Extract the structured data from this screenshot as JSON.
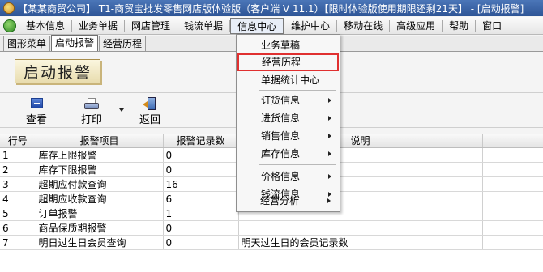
{
  "window": {
    "title": "【某某商贸公司】 T1-商贸宝批发零售网店版体验版（客户端 V 11.1）【限时体验版使用期限还剩21天】 - [启动报警]"
  },
  "menubar": {
    "items": [
      {
        "label": "基本信息"
      },
      {
        "label": "业务单据"
      },
      {
        "label": "网店管理"
      },
      {
        "label": "钱流单据"
      },
      {
        "label": "信息中心"
      },
      {
        "label": "维护中心"
      },
      {
        "label": "移动在线"
      },
      {
        "label": "高级应用"
      },
      {
        "label": "帮助"
      },
      {
        "label": "窗口"
      }
    ],
    "active_index": 4
  },
  "tabs": [
    {
      "label": "图形菜单"
    },
    {
      "label": "启动报警"
    },
    {
      "label": "经营历程"
    }
  ],
  "caption": "启动报警",
  "toolbar": {
    "view_label": "查看",
    "print_label": "打印",
    "back_label": "返回"
  },
  "table": {
    "columns": [
      "行号",
      "报警项目",
      "报警记录数",
      "说明"
    ],
    "rows": [
      {
        "no": "1",
        "item": "库存上限报警",
        "count": "0",
        "note": ""
      },
      {
        "no": "2",
        "item": "库存下限报警",
        "count": "0",
        "note": ""
      },
      {
        "no": "3",
        "item": "超期应付款查询",
        "count": "16",
        "note": ""
      },
      {
        "no": "4",
        "item": "超期应收款查询",
        "count": "6",
        "note": ""
      },
      {
        "no": "5",
        "item": "订单报警",
        "count": "1",
        "note": ""
      },
      {
        "no": "6",
        "item": "商品保质期报警",
        "count": "0",
        "note": ""
      },
      {
        "no": "7",
        "item": "明日过生日会员查询",
        "count": "0",
        "note": "明天过生日的会员记录数"
      }
    ]
  },
  "dropdown": {
    "items": [
      {
        "label": "业务草稿",
        "submenu": false
      },
      {
        "label": "经营历程",
        "submenu": false,
        "highlighted": true
      },
      {
        "label": "单据统计中心",
        "submenu": false
      },
      {
        "label": "订货信息",
        "submenu": true
      },
      {
        "label": "进货信息",
        "submenu": true
      },
      {
        "label": "销售信息",
        "submenu": true
      },
      {
        "label": "库存信息",
        "submenu": true
      },
      {
        "label": "价格信息",
        "submenu": true
      },
      {
        "label": "钱流信息",
        "submenu": true
      },
      {
        "label": "经营分析",
        "submenu": true
      }
    ],
    "highlight_color": "#e03030"
  }
}
